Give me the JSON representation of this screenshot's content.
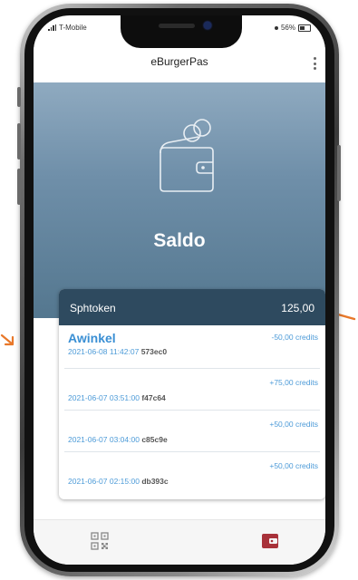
{
  "status_bar": {
    "carrier": "T-Mobile",
    "battery": "56%"
  },
  "header": {
    "title": "eBurgerPas"
  },
  "hero": {
    "title": "Saldo"
  },
  "balance_card": {
    "token_name": "Sphtoken",
    "token_balance": "125,00"
  },
  "transactions": [
    {
      "shop": "Awinkel",
      "datetime": "2021-06-08 11:42:07",
      "hash": "573ec0",
      "amount": "-50,00 credits"
    },
    {
      "shop": "",
      "datetime": "2021-06-07 03:51:00",
      "hash": "f47c64",
      "amount": "+75,00 credits"
    },
    {
      "shop": "",
      "datetime": "2021-06-07 03:04:00",
      "hash": "c85c9e",
      "amount": "+50,00 credits"
    },
    {
      "shop": "",
      "datetime": "2021-06-07 02:15:00",
      "hash": "db393c",
      "amount": "+50,00 credits"
    }
  ],
  "bottom_nav": {
    "items": [
      {
        "icon": "qr-code-icon",
        "active": false
      },
      {
        "icon": "wallet-icon",
        "active": true
      }
    ]
  },
  "colors": {
    "hero_top": "#8faac0",
    "hero_bottom": "#54778f",
    "card_header": "#2e4a5f",
    "link_blue": "#3a8fd4",
    "accent_red": "#a8323a",
    "annotation_orange": "#e8782a"
  }
}
